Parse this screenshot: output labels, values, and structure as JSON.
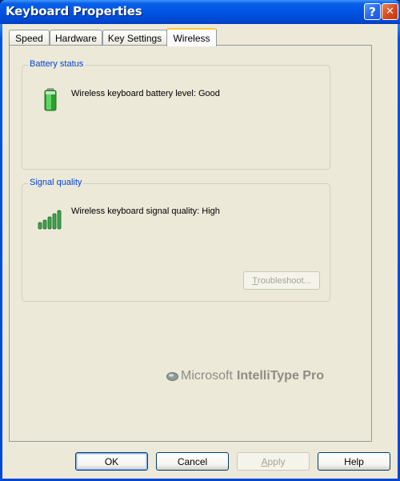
{
  "window": {
    "title": "Keyboard Properties",
    "help_button": "?",
    "close_button": "✕"
  },
  "tabs": [
    {
      "label": "Speed",
      "active": false
    },
    {
      "label": "Hardware",
      "active": false
    },
    {
      "label": "Key Settings",
      "active": false
    },
    {
      "label": "Wireless",
      "active": true
    }
  ],
  "battery": {
    "group_label": "Battery status",
    "icon": "battery-full-icon",
    "text": "Wireless keyboard battery level: Good"
  },
  "signal": {
    "group_label": "Signal quality",
    "icon": "signal-bars-icon",
    "text": "Wireless keyboard signal quality: High",
    "troubleshoot_first": "T",
    "troubleshoot_rest": "roubleshoot..."
  },
  "brand": {
    "logo": "microsoft-mouse-logo",
    "company": "Microsoft",
    "product": "IntelliType Pro"
  },
  "buttons": {
    "ok": "OK",
    "cancel": "Cancel",
    "apply_first": "A",
    "apply_rest": "pply",
    "help": "Help"
  },
  "colors": {
    "titlebar": "#0054e3",
    "group_label": "#0046d5",
    "battery_green": "#3cc23c",
    "signal_green": "#2e9a3e",
    "active_tab_accent": "#ffc83c"
  }
}
